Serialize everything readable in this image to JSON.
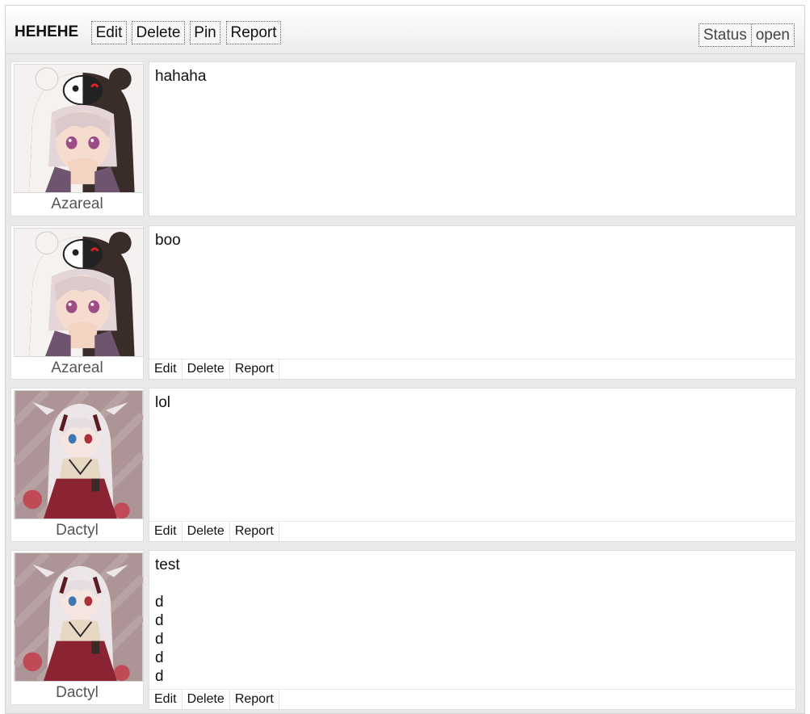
{
  "thread": {
    "title": "HEHEHE",
    "actions": [
      "Edit",
      "Delete",
      "Pin",
      "Report"
    ],
    "status_label": "Status",
    "status_value": "open"
  },
  "posts": [
    {
      "author": "Azareal",
      "avatar": "monokuma-hood-girl-avatar",
      "body": "hahaha",
      "actions": []
    },
    {
      "author": "Azareal",
      "avatar": "monokuma-hood-girl-avatar",
      "body": "boo",
      "actions": [
        "Edit",
        "Delete",
        "Report"
      ]
    },
    {
      "author": "Dactyl",
      "avatar": "white-hair-red-dress-girl-avatar",
      "body": "lol",
      "actions": [
        "Edit",
        "Delete",
        "Report"
      ]
    },
    {
      "author": "Dactyl",
      "avatar": "white-hair-red-dress-girl-avatar",
      "body": "test\n\nd\nd\nd\nd\nd",
      "actions": [
        "Edit",
        "Delete",
        "Report"
      ]
    }
  ],
  "colors": {
    "page_background": "#e9e9e9",
    "card_background": "#ffffff",
    "border": "#dedede",
    "author_text": "#555555"
  }
}
